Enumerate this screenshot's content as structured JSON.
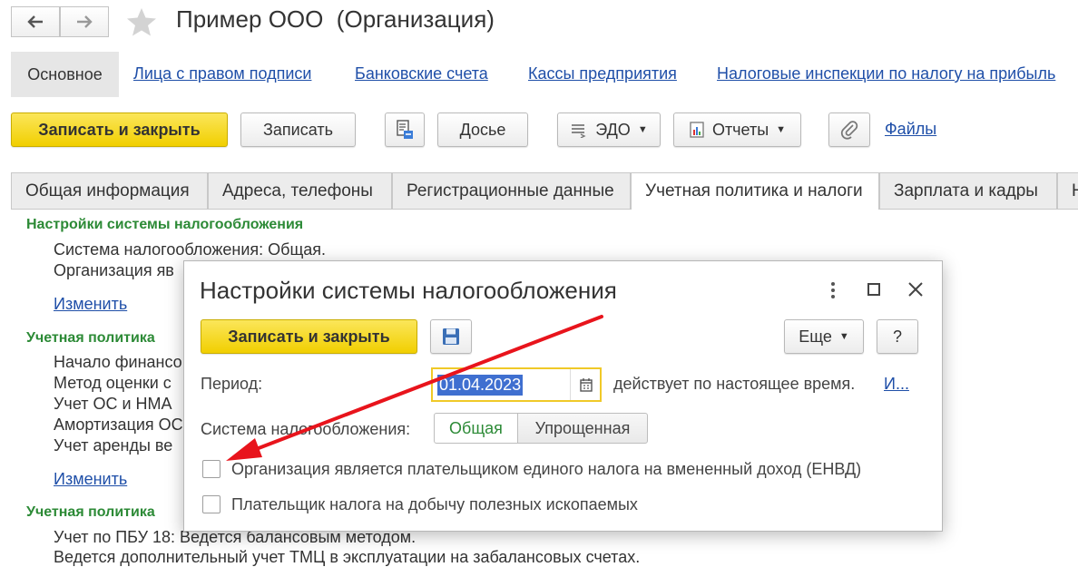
{
  "window": {
    "title": "Пример ООО  (Организация)"
  },
  "nav": {
    "back_icon": "arrow-left-icon",
    "forward_icon": "arrow-right-icon",
    "favorite_icon": "star-icon"
  },
  "top_tabs": [
    {
      "label": "Основное"
    },
    {
      "label": "Лица с правом подписи"
    },
    {
      "label": "Банковские счета"
    },
    {
      "label": "Кассы предприятия"
    },
    {
      "label": "Налоговые инспекции по налогу на прибыль"
    }
  ],
  "toolbar": {
    "save_close": "Записать и закрыть",
    "save": "Записать",
    "dossier": "Досье",
    "edo": "ЭДО",
    "reports": "Отчеты",
    "files": "Файлы"
  },
  "form_tabs": [
    {
      "label": "Общая информация"
    },
    {
      "label": "Адреса, телефоны"
    },
    {
      "label": "Регистрационные данные"
    },
    {
      "label": "Учетная политика и налоги"
    },
    {
      "label": "Зарплата и кадры"
    },
    {
      "label": "Н"
    }
  ],
  "content": {
    "section1_title": "Настройки системы налогообложения",
    "section1_lines": [
      "Система налогообложения: Общая.",
      "Организация яв"
    ],
    "change_link": "Изменить",
    "section2_title": "Учетная политика",
    "section2_lines": [
      "Начало финансо",
      "Метод оценки с",
      "Учет ОС и НМА",
      "Амортизация ОС",
      "Учет аренды ве"
    ],
    "change_link2": "Изменить",
    "section3_title": "Учетная политика",
    "section3_lines": [
      "Учет по ПБУ 18: Ведется балансовым методом.",
      "Ведется дополнительный учет ТМЦ в эксплуатации на забалансовых счетах."
    ]
  },
  "dialog": {
    "title": "Настройки системы налогообложения",
    "save_close": "Записать и закрыть",
    "more": "Еще",
    "help": "?",
    "period_label": "Период:",
    "period_value": "01.04.2023",
    "period_note": "действует по настоящее время.",
    "history_link": "И...",
    "tax_system_label": "Система налогообложения:",
    "tax_system_options": [
      "Общая",
      "Упрощенная"
    ],
    "tax_system_selected": "Общая",
    "checkbox_envd": "Организация является плательщиком единого налога на вмененный доход (ЕНВД)",
    "checkbox_envd_checked": false,
    "checkbox_ndpi": "Плательщик налога на добычу полезных ископаемых",
    "checkbox_ndpi_checked": false
  },
  "colors": {
    "accent_yellow": "#f5d90f",
    "section_green": "#2c8a36",
    "link_blue": "#1f4fa8",
    "arrow_red": "#e8141c",
    "date_highlight": "#3f6fd0"
  }
}
